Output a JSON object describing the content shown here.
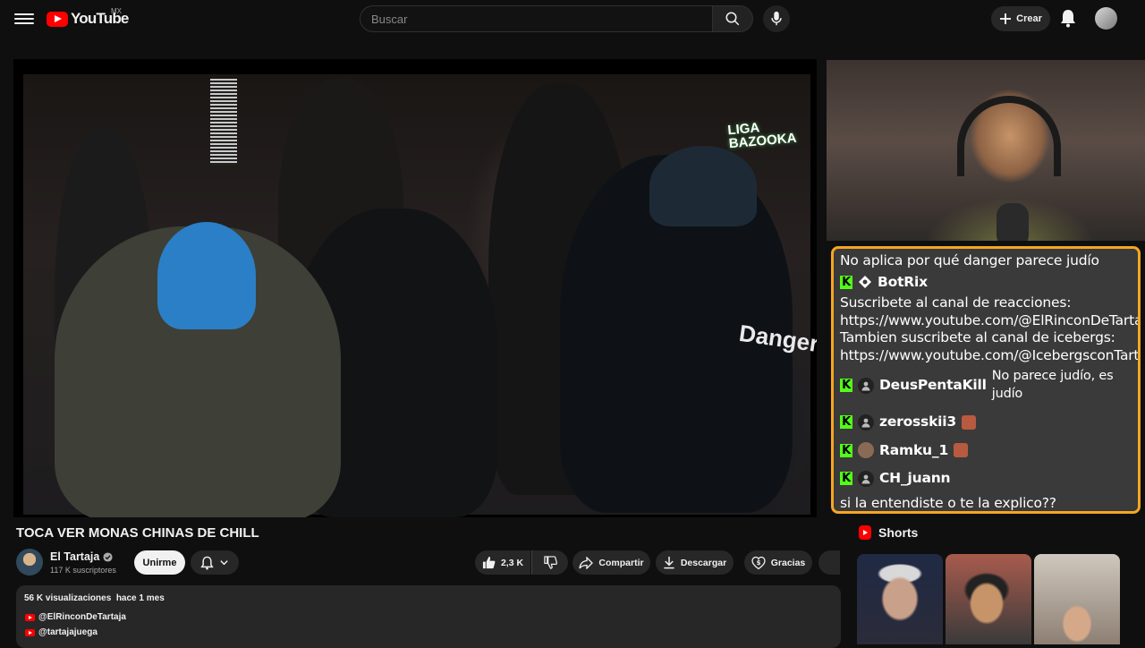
{
  "header": {
    "logo_text": "YouTube",
    "country_code": "MX",
    "search_placeholder": "Buscar",
    "create_label": "Crear",
    "icons": [
      "menu-icon",
      "search-icon",
      "mic-icon",
      "plus-icon",
      "bell-icon"
    ]
  },
  "video": {
    "title": "TOCA VER MONAS CHINAS DE CHILL",
    "overlay_logo": "LIGA BAZOOKA",
    "overlay_jacket_text": "Danger"
  },
  "channel": {
    "name": "El Tartaja",
    "subscribers": "117 K suscriptores",
    "join_label": "Unirme"
  },
  "actions": {
    "likes": "2,3 K",
    "share_label": "Compartir",
    "download_label": "Descargar",
    "thanks_label": "Gracias"
  },
  "description": {
    "meta": "56 K visualizaciones  hace 1 mes",
    "links": [
      "@ElRinconDeTartaja",
      "@tartajajuega"
    ]
  },
  "chat": {
    "border_color": "#f5a623",
    "messages": [
      {
        "text": "No aplica por qué danger parece judío"
      },
      {
        "user": "BotRix"
      },
      {
        "text": "Suscribete al canal de reacciones: https://www.youtube.com/@ElRinconDeTartaja Tambien suscribete al canal de icebergs: https://www.youtube.com/@IcebergsconTartaja"
      },
      {
        "user": "DeusPentaKill",
        "text": "No parece judío, es judío"
      },
      {
        "user": "zerosskii3"
      },
      {
        "user": "Ramku_1"
      },
      {
        "user": "CH_juann"
      },
      {
        "text": "si la entendiste o te la explico??"
      }
    ]
  },
  "shorts": {
    "title": "Shorts",
    "count": 3
  }
}
